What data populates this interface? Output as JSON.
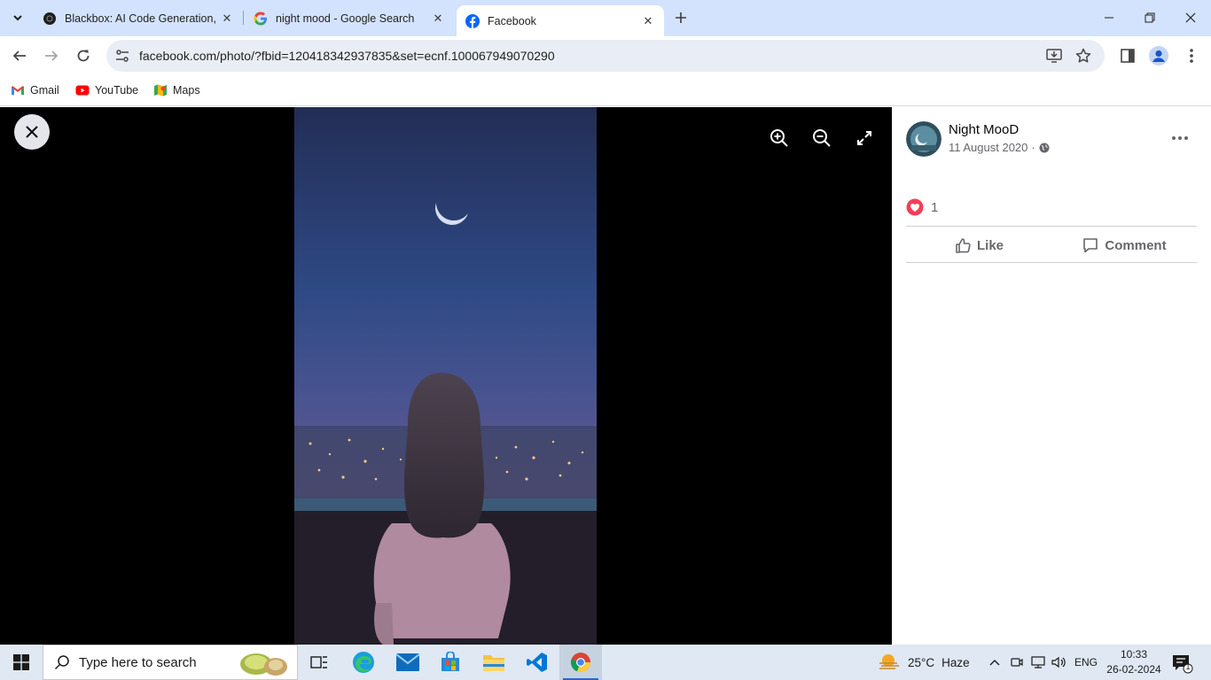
{
  "browser": {
    "tabs": [
      {
        "title": "Blackbox: AI Code Generation, C",
        "active": false
      },
      {
        "title": "night mood - Google Search",
        "active": false
      },
      {
        "title": "Facebook",
        "active": true
      }
    ],
    "url": "facebook.com/photo/?fbid=120418342937835&set=ecnf.100067949070290",
    "bookmarks": [
      {
        "label": "Gmail"
      },
      {
        "label": "YouTube"
      },
      {
        "label": "Maps"
      }
    ]
  },
  "post": {
    "page_name": "Night MooD",
    "date": "11 August 2020",
    "date_separator": "·",
    "reaction_count": "1",
    "actions": {
      "like": "Like",
      "comment": "Comment"
    }
  },
  "taskbar": {
    "search_placeholder": "Type here to search",
    "weather": {
      "temp": "25°C",
      "condition": "Haze"
    },
    "language": "ENG",
    "time": "10:33",
    "date": "26-02-2024",
    "notification_count": "1"
  },
  "colors": {
    "tabstrip": "#d3e3fd",
    "omnibox": "#e9eef6",
    "facebook_blue": "#0866ff",
    "viewer_bg": "#000000",
    "taskbar": "#dfe8f3"
  }
}
